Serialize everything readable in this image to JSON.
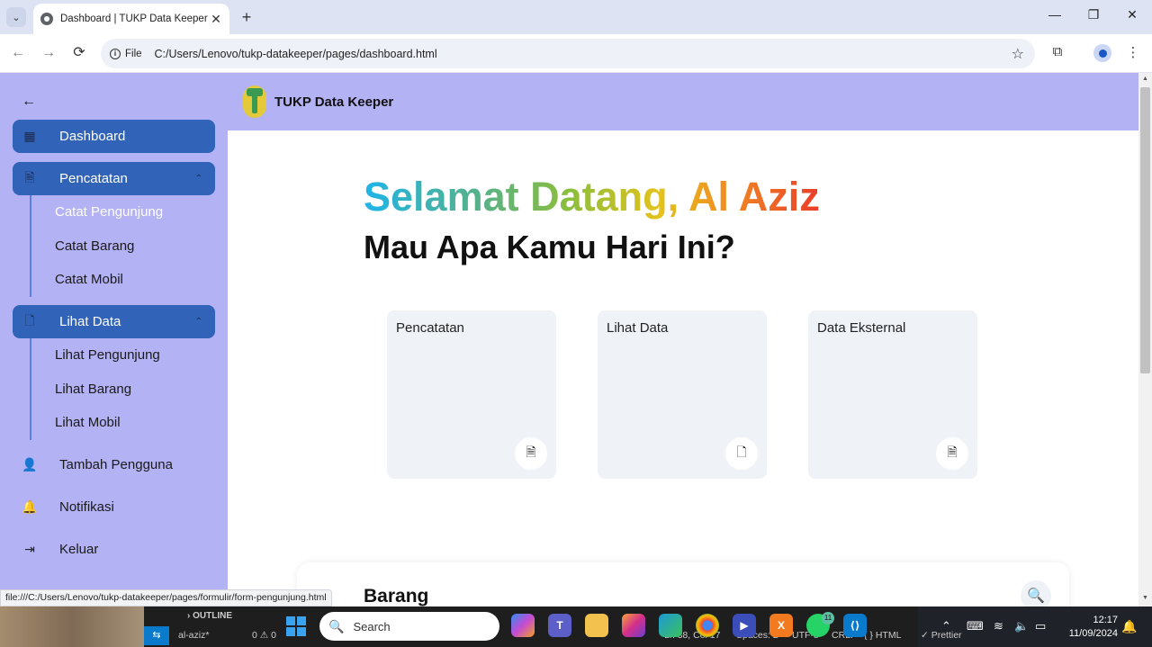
{
  "browser": {
    "tab_title": "Dashboard | TUKP Data Keeper",
    "tab_close": "✕",
    "new_tab": "+",
    "address_chip": "File",
    "url": "C:/Users/Lenovo/tukp-datakeeper/pages/dashboard.html",
    "status_url": "file:///C:/Users/Lenovo/tukp-datakeeper/pages/formulir/form-pengunjung.html"
  },
  "topbar": {
    "brand": "TUKP Data Keeper"
  },
  "sidebar": {
    "main_items": {
      "dashboard": "Dashboard",
      "pencatatan": "Pencatatan",
      "lihat_data": "Lihat Data",
      "tambah_pengguna": "Tambah Pengguna",
      "notifikasi": "Notifikasi",
      "keluar": "Keluar"
    },
    "pencatatan_sub": [
      "Catat Pengunjung",
      "Catat Barang",
      "Catat Mobil"
    ],
    "lihat_data_sub": [
      "Lihat Pengunjung",
      "Lihat Barang",
      "Lihat Mobil"
    ]
  },
  "main": {
    "greeting": "Selamat Datang, Al Aziz",
    "question": "Mau Apa Kamu Hari Ini?",
    "cards": [
      "Pencatatan",
      "Lihat Data",
      "Data Eksternal"
    ],
    "panel_title": "Barang"
  },
  "taskbar": {
    "vscode_outline": "OUTLINE",
    "vscode_branch": "al-aziz*",
    "vscode_problems": "0 ⚠ 0",
    "vscode_cursor": "Ln 38, Col 17",
    "vscode_spaces": "Spaces: 2",
    "vscode_encoding": "UTF-8",
    "vscode_eol": "CRLF",
    "vscode_lang": "{ } HTML",
    "vscode_prettier": "✓ Prettier",
    "search_placeholder": "Search",
    "whatsapp_badge": "11",
    "time": "12:17",
    "date": "11/09/2024"
  },
  "icons": {
    "back": "←",
    "forward": "→",
    "reload": "⟳",
    "star": "☆",
    "extensions": "⧉",
    "menu": "⋮",
    "minimize": "—",
    "maximize": "❐",
    "close": "✕",
    "sidebar_back": "←",
    "chevron_up": "⌃",
    "search": "🔍"
  },
  "colors": {
    "sidebar_bg": "#b3b2f4",
    "active_nav": "#3163b8",
    "card_bg": "#eff3f8"
  }
}
